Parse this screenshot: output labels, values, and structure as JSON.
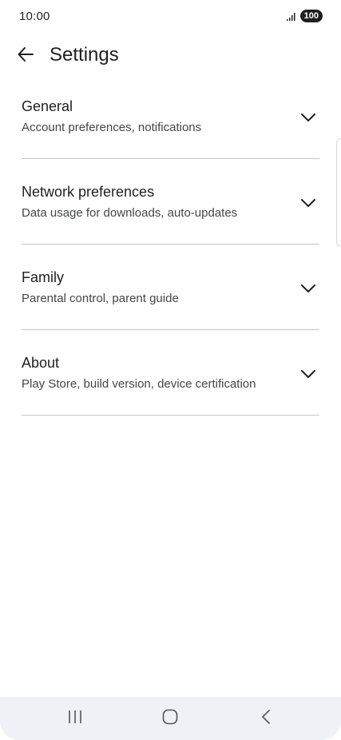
{
  "status_bar": {
    "time": "10:00",
    "battery": "100",
    "signal_icon": "signal-bars-icon"
  },
  "app_bar": {
    "back_icon": "arrow-back-icon",
    "title": "Settings"
  },
  "settings": {
    "items": [
      {
        "title": "General",
        "subtitle": "Account preferences, notifications"
      },
      {
        "title": "Network preferences",
        "subtitle": "Data usage for downloads, auto-updates"
      },
      {
        "title": "Family",
        "subtitle": "Parental control, parent guide"
      },
      {
        "title": "About",
        "subtitle": "Play Store, build version, device certification"
      }
    ]
  },
  "nav_bar": {
    "recents_icon": "recents-icon",
    "home_icon": "home-icon",
    "back_icon": "back-chevron-icon"
  },
  "colors": {
    "text_primary": "#1f1f1f",
    "text_secondary": "#444746",
    "divider": "#c4c7c5",
    "nav_bar_bg": "#eef1f5"
  }
}
